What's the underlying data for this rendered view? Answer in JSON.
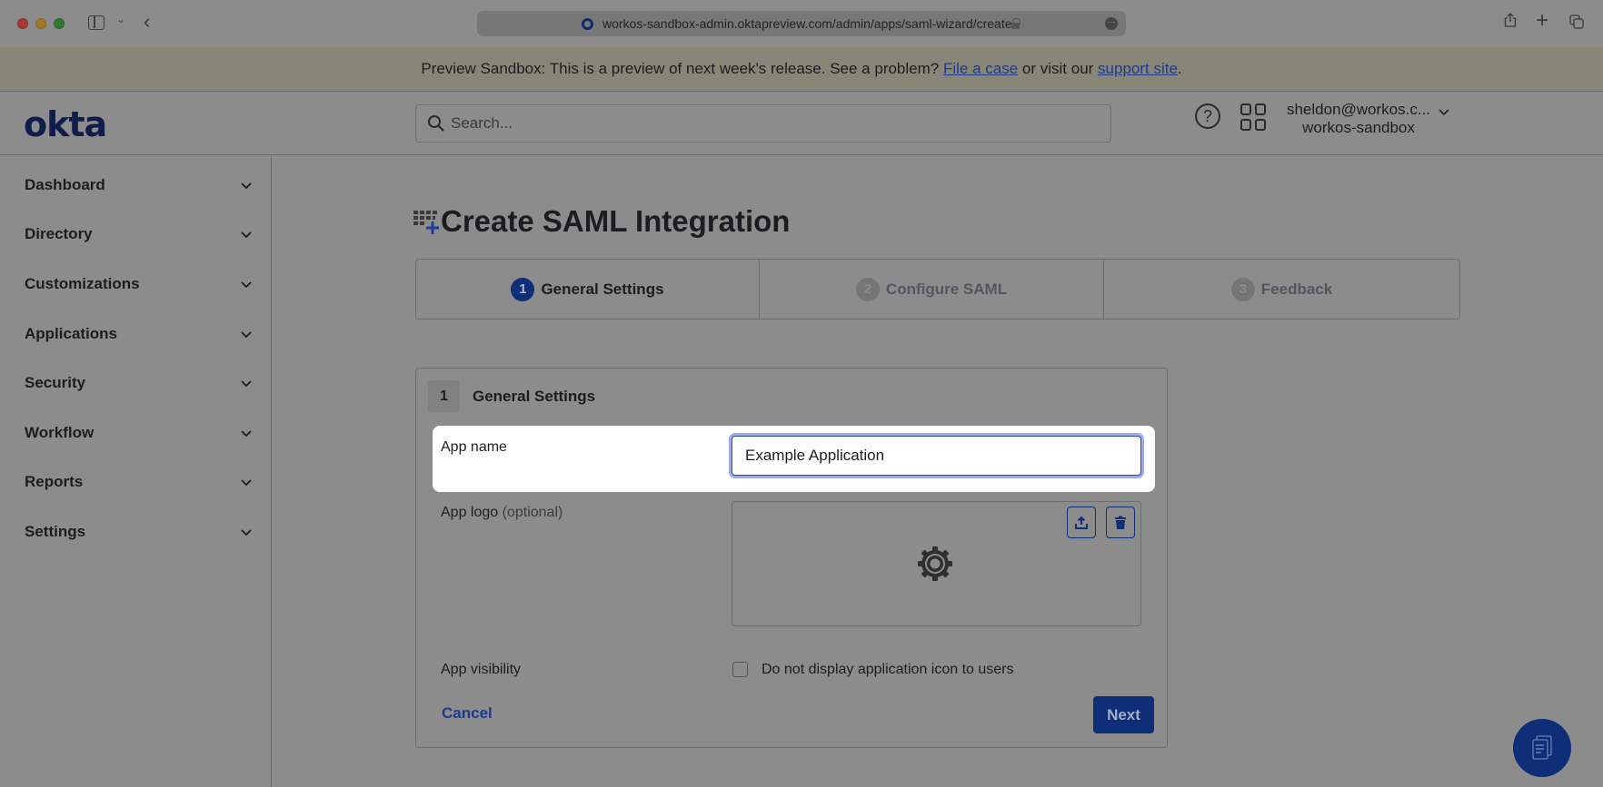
{
  "browser": {
    "url": "workos-sandbox-admin.oktapreview.com/admin/apps/saml-wizard/create",
    "icons": [
      "close-window",
      "minimize-window",
      "maximize-window",
      "sidebar-toggle-icon",
      "chevron-down-icon",
      "back-arrow-icon",
      "lock-icon",
      "more-icon",
      "share-icon",
      "plus-icon",
      "tabs-overview-icon"
    ]
  },
  "banner": {
    "text_before": "Preview Sandbox: This is a preview of next week's release. See a problem? ",
    "link1": "File a case",
    "text_middle": " or visit our ",
    "link2": "support site",
    "text_after": "."
  },
  "header": {
    "logo": "okta",
    "search_placeholder": "Search...",
    "user_email": "sheldon@workos.c...",
    "user_org": "workos-sandbox"
  },
  "sidebar": {
    "items": [
      {
        "label": "Dashboard"
      },
      {
        "label": "Directory"
      },
      {
        "label": "Customizations"
      },
      {
        "label": "Applications"
      },
      {
        "label": "Security"
      },
      {
        "label": "Workflow"
      },
      {
        "label": "Reports"
      },
      {
        "label": "Settings"
      }
    ]
  },
  "main": {
    "title": "Create SAML Integration",
    "steps": [
      {
        "num": "1",
        "label": "General Settings",
        "state": "active"
      },
      {
        "num": "2",
        "label": "Configure SAML",
        "state": "inactive"
      },
      {
        "num": "3",
        "label": "Feedback",
        "state": "inactive"
      }
    ],
    "card": {
      "num": "1",
      "title": "General Settings",
      "app_name_label": "App name",
      "app_name_value": "Example Application",
      "app_logo_label": "App logo",
      "app_logo_optional": "(optional)",
      "app_visibility_label": "App visibility",
      "visibility_checkbox_label": "Do not display application icon to users",
      "visibility_checked": false,
      "cancel_label": "Cancel",
      "next_label": "Next"
    }
  },
  "colors": {
    "brand_navy": "#0f2e78",
    "link_blue": "#1e3a8a",
    "focus_ring": "#9eabe6"
  }
}
